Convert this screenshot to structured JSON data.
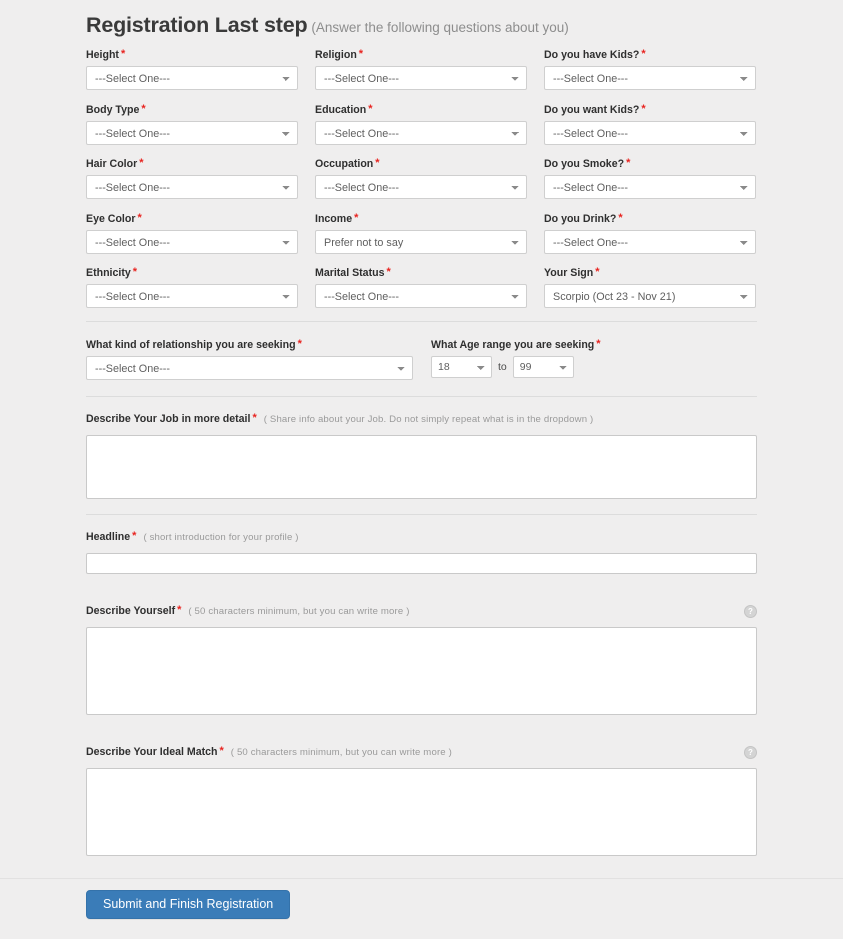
{
  "header": {
    "title": "Registration Last step",
    "subtitle": "(Answer the following questions about you)"
  },
  "required_marker": "*",
  "colors": {
    "page_background": "#efeeee",
    "required_red": "#e8231f",
    "submit_blue": "#3a7cb8",
    "field_border": "#cfcfcf",
    "divider": "#dcdcdc"
  },
  "placeholder_select": "---Select One---",
  "select_fields": [
    {
      "label": "Height",
      "value": "---Select One---",
      "required": true
    },
    {
      "label": "Religion",
      "value": "---Select One---",
      "required": true
    },
    {
      "label": "Do you have Kids?",
      "value": "---Select One---",
      "required": true
    },
    {
      "label": "Body Type",
      "value": "---Select One---",
      "required": true
    },
    {
      "label": "Education",
      "value": "---Select One---",
      "required": true
    },
    {
      "label": "Do you want Kids?",
      "value": "---Select One---",
      "required": true
    },
    {
      "label": "Hair Color",
      "value": "---Select One---",
      "required": true
    },
    {
      "label": "Occupation",
      "value": "---Select One---",
      "required": true
    },
    {
      "label": "Do you Smoke?",
      "value": "---Select One---",
      "required": true
    },
    {
      "label": "Eye Color",
      "value": "---Select One---",
      "required": true
    },
    {
      "label": "Income",
      "value": "Prefer not to say",
      "required": true
    },
    {
      "label": "Do you Drink?",
      "value": "---Select One---",
      "required": true
    },
    {
      "label": "Ethnicity",
      "value": "---Select One---",
      "required": true
    },
    {
      "label": "Marital Status",
      "value": "---Select One---",
      "required": true
    },
    {
      "label": "Your Sign",
      "value": "Scorpio (Oct 23 - Nov 21)",
      "required": true
    }
  ],
  "seeking": {
    "relationship_label": "What kind of relationship you are seeking",
    "relationship_value": "---Select One---",
    "age_label": "What Age range you are seeking",
    "age_from": "18",
    "age_to_word": "to",
    "age_to": "99"
  },
  "job": {
    "label": "Describe Your Job in more detail",
    "hint": "( Share info about your Job. Do not simply repeat what is in the dropdown )",
    "value": ""
  },
  "headline": {
    "label": "Headline",
    "hint": "( short introduction for your profile )",
    "value": ""
  },
  "describe_yourself": {
    "label": "Describe Yourself",
    "hint": "( 50 characters minimum, but you can write more )",
    "value": "",
    "info_icon": "?"
  },
  "ideal_match": {
    "label": "Describe Your Ideal Match",
    "hint": "( 50 characters minimum, but you can write more )",
    "value": "",
    "info_icon": "?"
  },
  "submit": {
    "label": "Submit and Finish Registration"
  }
}
